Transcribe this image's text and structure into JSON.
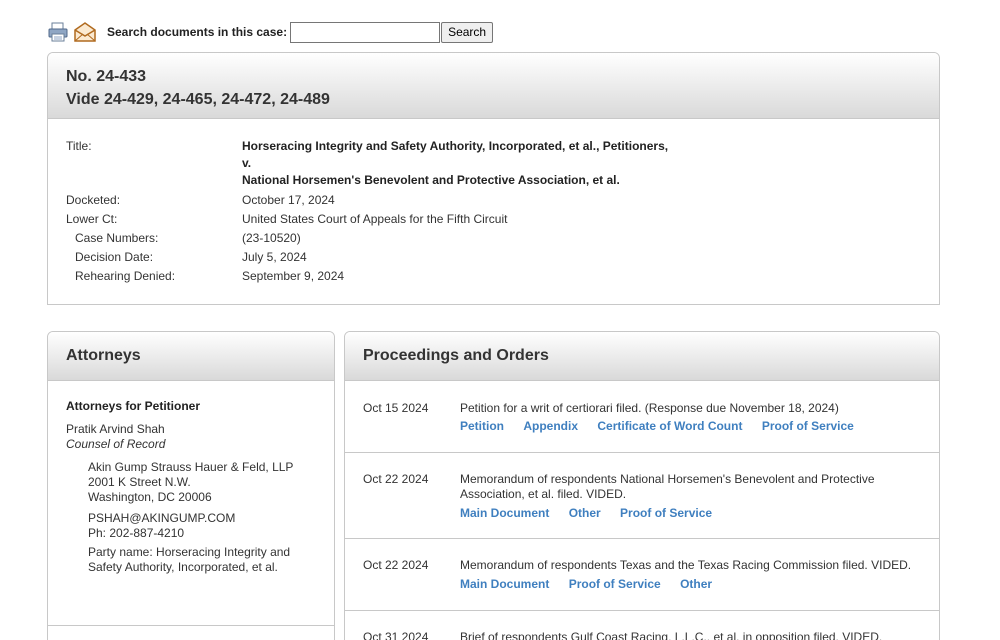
{
  "toolbar": {
    "print_icon": "printer-icon",
    "email_icon": "envelope-icon",
    "search_label": "Search documents in this case:",
    "search_value": "",
    "search_button": "Search"
  },
  "case": {
    "number": "No. 24-433",
    "vide": "Vide 24-429, 24-465, 24-472, 24-489",
    "title_label": "Title:",
    "title_line1": "Horseracing Integrity and Safety Authority, Incorporated, et al., Petitioners,",
    "title_line2": "v.",
    "title_line3": "National Horsemen's Benevolent and Protective Association, et al.",
    "docketed_label": "Docketed:",
    "docketed": "October 17, 2024",
    "lower_ct_label": "Lower Ct:",
    "lower_ct": "United States Court of Appeals for the Fifth Circuit",
    "case_numbers_label": "Case Numbers:",
    "case_numbers": "(23-10520)",
    "decision_date_label": "Decision Date:",
    "decision_date": "July 5, 2024",
    "rehearing_label": "Rehearing Denied:",
    "rehearing": "September 9, 2024"
  },
  "attorneys": {
    "heading": "Attorneys",
    "group_heading": "Attorneys for Petitioner",
    "name": "Pratik Arvind Shah",
    "role": "Counsel of Record",
    "firm": "Akin Gump Strauss Hauer & Feld, LLP",
    "street": "2001 K Street N.W.",
    "city": "Washington, DC 20006",
    "email": "PSHAH@AKINGUMP.COM",
    "phone": "Ph: 202-887-4210",
    "party": "Party name: Horseracing Integrity and Safety Authority, Incorporated, et al."
  },
  "proceedings": {
    "heading": "Proceedings and Orders",
    "entries": [
      {
        "date": "Oct 15 2024",
        "text": "Petition for a writ of certiorari filed. (Response due November 18, 2024)",
        "links": [
          "Petition",
          "Appendix",
          "Certificate of Word Count",
          "Proof of Service"
        ]
      },
      {
        "date": "Oct 22 2024",
        "text": "Memorandum of respondents National Horsemen's Benevolent and Protective Association, et al. filed. VIDED.",
        "links": [
          "Main Document",
          "Other",
          "Proof of Service"
        ]
      },
      {
        "date": "Oct 22 2024",
        "text": "Memorandum of respondents Texas and the Texas Racing Commission filed. VIDED.",
        "links": [
          "Main Document",
          "Proof of Service",
          "Other"
        ]
      },
      {
        "date": "Oct 31 2024",
        "text": "Brief of respondents Gulf Coast Racing, L.L.C., et al. in opposition filed. VIDED.",
        "links": []
      }
    ]
  },
  "colors": {
    "link": "#3f7fbf",
    "border": "#c8c8c8",
    "header_gradient_top": "#ffffff",
    "header_gradient_bottom": "#d9d9d9"
  }
}
